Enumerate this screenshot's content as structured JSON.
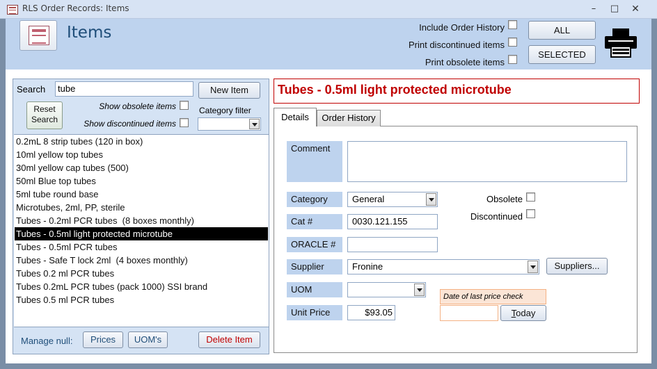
{
  "window": {
    "title": "RLS Order Records: Items",
    "minimize": "–",
    "maximize": "□",
    "close": "✕"
  },
  "header": {
    "form_title": "Items",
    "include_order_history_label": "Include Order History",
    "print_discontinued_label": "Print discontinued items",
    "print_obsolete_label": "Print obsolete items",
    "all_button": "ALL",
    "selected_button": "SELECTED"
  },
  "left": {
    "search_label": "Search",
    "search_value": "tube",
    "new_item_button": "New Item",
    "reset_search_line1": "Reset",
    "reset_search_line2": "Search",
    "show_obsolete_label": "Show obsolete items",
    "show_discontinued_label": "Show discontinued items",
    "category_filter_label": "Category filter",
    "category_filter_value": "",
    "items": [
      "0.2mL 8 strip tubes (120 in box)",
      "10ml yellow top tubes",
      "30ml yellow cap tubes (500)",
      "50ml Blue top tubes",
      "5ml tube round base",
      "Microtubes, 2ml, PP, sterile",
      "Tubes - 0.2ml PCR tubes  (8 boxes monthly)",
      "Tubes - 0.5ml light protected microtube",
      "Tubes - 0.5ml PCR tubes",
      "Tubes - Safe T lock 2ml  (4 boxes monthly)",
      "Tubes 0.2 ml PCR tubes",
      "Tubes 0.2mL PCR tubes (pack 1000) SSI brand",
      "Tubes 0.5 ml PCR tubes"
    ],
    "selected_index": 7,
    "manage_null_label": "Manage null:",
    "prices_button": "Prices",
    "uoms_button": "UOM's",
    "delete_button": "Delete Item"
  },
  "detail": {
    "title": "Tubes - 0.5ml light protected microtube",
    "tab_details": "Details",
    "tab_history": "Order History",
    "comment_label": "Comment",
    "comment_value": "",
    "category_label": "Category",
    "category_value": "General",
    "cat_no_label": "Cat #",
    "cat_no_value": "0030.121.155",
    "oracle_label": "ORACLE #",
    "oracle_value": "",
    "supplier_label": "Supplier",
    "supplier_value": "Fronine",
    "uom_label": "UOM",
    "uom_value": "",
    "unit_price_label": "Unit Price",
    "unit_price_value": "$93.05",
    "obsolete_label": "Obsolete",
    "discontinued_label": "Discontinued",
    "suppliers_button": "Suppliers...",
    "price_check_label": "Date of last price check",
    "price_check_value": "",
    "today_button_first": "T",
    "today_button_rest": "oday"
  },
  "colors": {
    "header_band": "#bed3ee",
    "title_red": "#c00000",
    "label_blue": "#1f4e79",
    "list_panel": "#d5e3f4",
    "selected_row": "#000000"
  }
}
